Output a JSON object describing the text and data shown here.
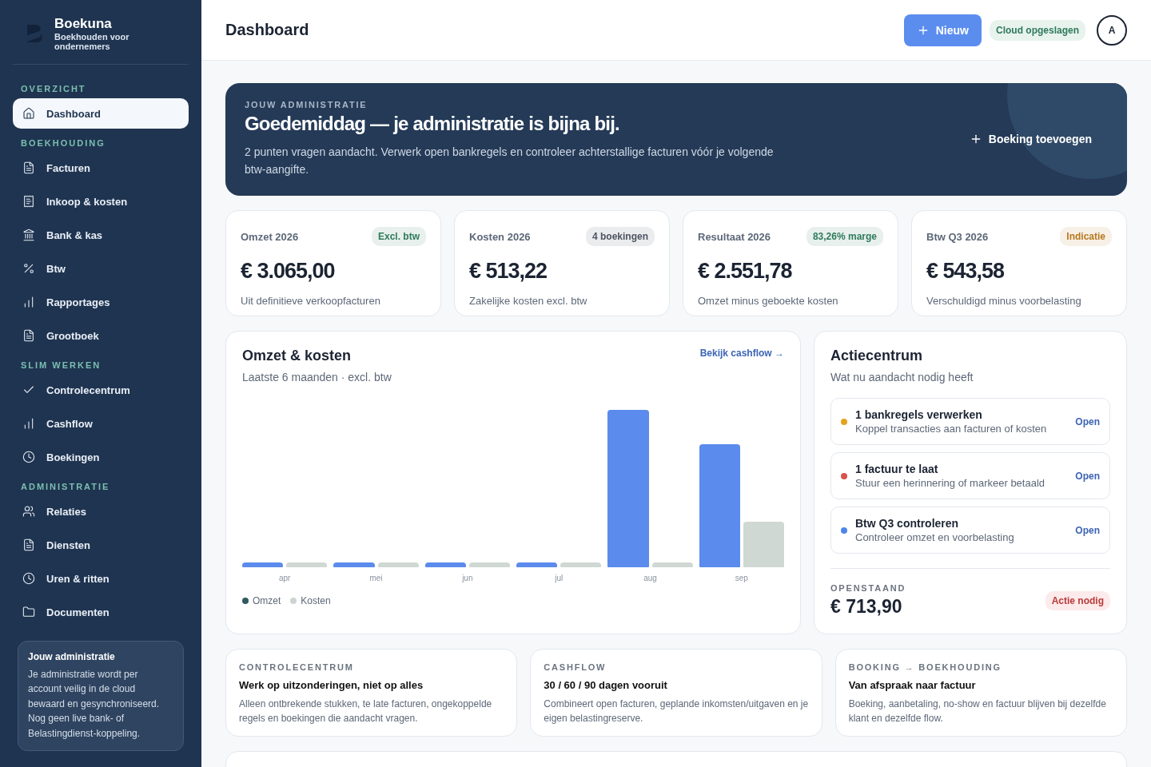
{
  "brand": {
    "name": "Boekuna",
    "tagline": "Boekhouden voor ondernemers"
  },
  "nav": [
    {
      "heading": "OVERZICHT",
      "items": [
        {
          "label": "Dashboard",
          "selected": true
        }
      ]
    },
    {
      "heading": "BOEKHOUDING",
      "items": [
        {
          "label": "Facturen",
          "selected": false
        },
        {
          "label": "Inkoop & kosten",
          "selected": false
        },
        {
          "label": "Bank & kas",
          "selected": false
        },
        {
          "label": "Btw",
          "selected": false
        },
        {
          "label": "Rapportages",
          "selected": false
        },
        {
          "label": "Grootboek",
          "selected": false
        }
      ]
    },
    {
      "heading": "SLIM WERKEN",
      "items": [
        {
          "label": "Controlecentrum",
          "selected": false
        },
        {
          "label": "Cashflow",
          "selected": false
        },
        {
          "label": "Boekingen",
          "selected": false
        }
      ]
    },
    {
      "heading": "ADMINISTRATIE",
      "items": [
        {
          "label": "Relaties",
          "selected": false
        },
        {
          "label": "Diensten",
          "selected": false
        },
        {
          "label": "Uren & ritten",
          "selected": false
        },
        {
          "label": "Documenten",
          "selected": false
        }
      ]
    }
  ],
  "sidebar_note": {
    "title": "Jouw administratie",
    "text": "Je administratie wordt per account veilig in de cloud bewaard en gesynchroniseerd. Nog geen live bank- of Belastingdienst-koppeling."
  },
  "header": {
    "title": "Dashboard",
    "new_button": "Nieuw",
    "status": "Cloud opgeslagen",
    "avatar": "A"
  },
  "hero": {
    "eyebrow": "JOUW ADMINISTRATIE",
    "title": "Goedemiddag — je administratie is bijna bij.",
    "text": "2 punten vragen aandacht. Verwerk open bankregels en controleer achterstallige facturen vóór je volgende btw-aangifte.",
    "button": "Boeking toevoegen"
  },
  "stats": [
    {
      "label": "Omzet 2026",
      "badge": "Excl. btw",
      "color": "#2f7a5b",
      "value": "€ 3.065,00",
      "note": "Uit definitieve verkoopfacturen"
    },
    {
      "label": "Kosten 2026",
      "badge": "4 boekingen",
      "color": "#4c5563",
      "value": "€ 513,22",
      "note": "Zakelijke kosten excl. btw"
    },
    {
      "label": "Resultaat 2026",
      "badge": "83,26% marge",
      "color": "#2f7a5b",
      "value": "€ 2.551,78",
      "note": "Omzet minus geboekte kosten"
    },
    {
      "label": "Btw Q3 2026",
      "badge": "Indicatie",
      "color": "#b7791f",
      "value": "€ 543,58",
      "note": "Verschuldigd minus voorbelasting"
    }
  ],
  "chart_card": {
    "title": "Omzet & kosten",
    "subtitle": "Laatste 6 maanden · excl. btw",
    "link": "Bekijk cashflow →",
    "months": [
      "apr",
      "mei",
      "jun",
      "jul",
      "aug",
      "sep"
    ],
    "legend": [
      {
        "name": "Omzet",
        "color": "#2f5a5e"
      },
      {
        "name": "Kosten",
        "color": "#cbd5d1"
      }
    ]
  },
  "actions": {
    "title": "Actiecentrum",
    "subtitle": "Wat nu aandacht nodig heeft",
    "items": [
      {
        "title": "1 bankregels verwerken",
        "text": "Koppel transacties aan facturen of kosten",
        "link": "Open",
        "color": "#e5a21f"
      },
      {
        "title": "1 factuur te laat",
        "text": "Stuur een herinnering of markeer betaald",
        "link": "Open",
        "color": "#d9534f"
      },
      {
        "title": "Btw Q3 controleren",
        "text": "Controleer omzet en voorbelasting",
        "link": "Open",
        "color": "#4f86ec"
      }
    ],
    "outstanding_label": "OPENSTAAND",
    "outstanding_value": "€ 713,90",
    "badge": "Actie nodig"
  },
  "info_cards": [
    {
      "eyebrow": "CONTROLECENTRUM",
      "title": "Werk op uitzonderingen, niet op alles",
      "text": "Alleen ontbrekende stukken, te late facturen, ongekoppelde regels en boekingen die aandacht vragen."
    },
    {
      "eyebrow": "CASHFLOW",
      "title": "30 / 60 / 90 dagen vooruit",
      "text": "Combineert open facturen, geplande inkomsten/uitgaven en je eigen belastingreserve."
    },
    {
      "eyebrow": "BOOKING → BOEKHOUDING",
      "title": "Van afspraak naar factuur",
      "text": "Boeking, aanbetaling, no-show en factuur blijven bij dezelfde klant en dezelfde flow."
    }
  ]
}
